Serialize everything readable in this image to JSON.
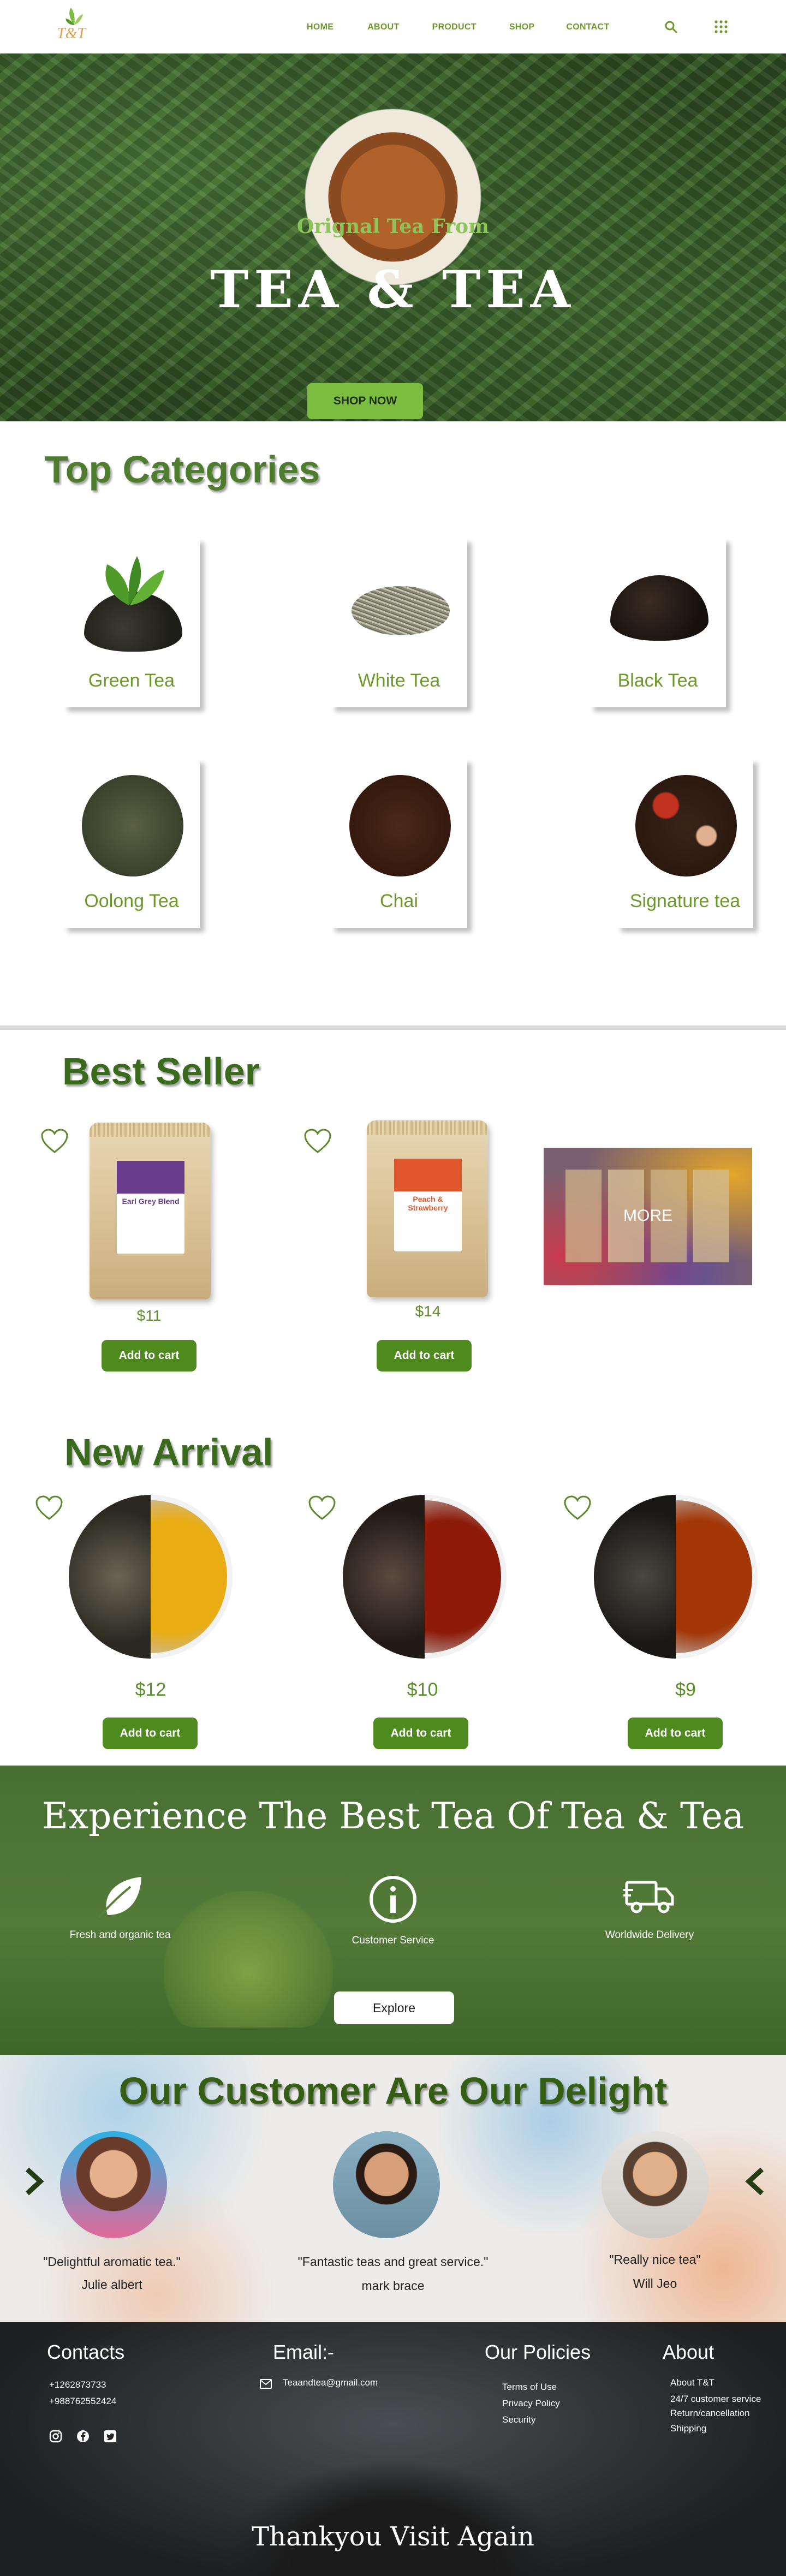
{
  "brand": {
    "logo_text": "T&T"
  },
  "nav": {
    "items": [
      "HOME",
      "ABOUT",
      "PRODUCT",
      "SHOP",
      "CONTACT"
    ],
    "icons": [
      "search-icon",
      "grid-menu-icon"
    ]
  },
  "hero": {
    "subtitle": "Orignal Tea From",
    "title": "TEA & TEA",
    "button": "SHOP NOW"
  },
  "categories": {
    "title": "Top Categories",
    "items": [
      {
        "label": "Green Tea"
      },
      {
        "label": "White Tea"
      },
      {
        "label": "Black Tea"
      },
      {
        "label": "Oolong Tea"
      },
      {
        "label": "Chai"
      },
      {
        "label": "Signature tea"
      }
    ]
  },
  "best_seller": {
    "title": "Best Seller",
    "products": [
      {
        "name": "Earl Grey Blend",
        "price": "$11",
        "button": "Add to cart",
        "band_color": "#6a3c8e"
      },
      {
        "name": "Peach & Strawberry",
        "price": "$14",
        "button": "Add to cart",
        "band_color": "#e2562e"
      }
    ],
    "more_label": "MORE"
  },
  "new_arrival": {
    "title": "New Arrival",
    "products": [
      {
        "price": "$12",
        "button": "Add to cart",
        "tea_color": "#e9ac12"
      },
      {
        "price": "$10",
        "button": "Add to cart",
        "tea_color": "#8c1a08"
      },
      {
        "price": "$9",
        "button": "Add to cart",
        "tea_color": "#a23606"
      }
    ]
  },
  "experience": {
    "title": "Experience The Best Tea Of Tea & Tea",
    "features": [
      {
        "icon": "leaf-icon",
        "label": "Fresh and organic tea"
      },
      {
        "icon": "info-icon",
        "label": "Customer Service"
      },
      {
        "icon": "delivery-truck-icon",
        "label": "Worldwide Delivery"
      }
    ],
    "button": "Explore"
  },
  "testimonials": {
    "title": "Our Customer Are Our Delight",
    "items": [
      {
        "quote": "\"Delightful aromatic tea.\"",
        "name": "Julie albert"
      },
      {
        "quote": "\"Fantastic teas and great service.\"",
        "name": "mark brace"
      },
      {
        "quote": "\"Really nice tea\"",
        "name": "Will Jeo"
      }
    ]
  },
  "footer": {
    "contacts": {
      "heading": "Contacts",
      "phone1": "+1262873733",
      "phone2": "+988762552424"
    },
    "email": {
      "heading": "Email:-",
      "address": "Teaandtea@gmail.com"
    },
    "policies": {
      "heading": "Our Policies",
      "links": [
        "Terms of Use",
        "Privacy Policy",
        "Security"
      ]
    },
    "about": {
      "heading": "About",
      "links": [
        "About T&T",
        "24/7  customer service",
        "Return/cancellation",
        "Shipping"
      ]
    },
    "thanks": "Thankyou Visit Again"
  }
}
